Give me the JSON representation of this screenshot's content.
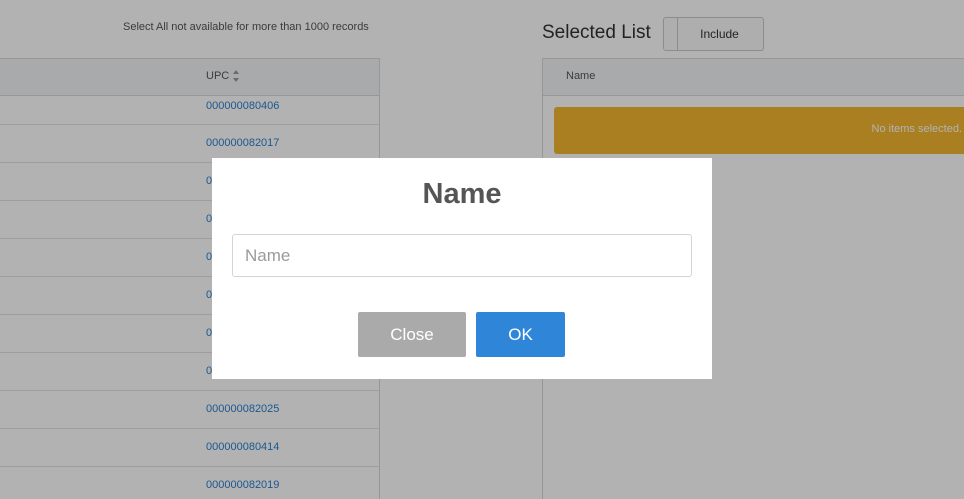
{
  "left_panel": {
    "select_all_note": "Select All not available for more than 1000 records",
    "upc_header": "UPC",
    "rows": [
      {
        "upc": "000000080406"
      },
      {
        "upc": "000000082017"
      },
      {
        "upc": "0"
      },
      {
        "upc": "0"
      },
      {
        "upc": "0"
      },
      {
        "upc": "0"
      },
      {
        "upc": "0"
      },
      {
        "upc": "0"
      },
      {
        "upc": "000000082025"
      },
      {
        "upc": "000000080414"
      },
      {
        "upc": "000000082019"
      }
    ]
  },
  "right_panel": {
    "title": "Selected List",
    "include_label": "Include",
    "name_header": "Name",
    "empty_message": "No items selected."
  },
  "modal": {
    "title": "Name",
    "input_placeholder": "Name",
    "input_value": "",
    "close_label": "Close",
    "ok_label": "OK"
  },
  "colors": {
    "link": "#2a7fd0",
    "alert": "#f2b631",
    "ok_button": "#2f86d9",
    "close_button": "#aaaaaa"
  }
}
